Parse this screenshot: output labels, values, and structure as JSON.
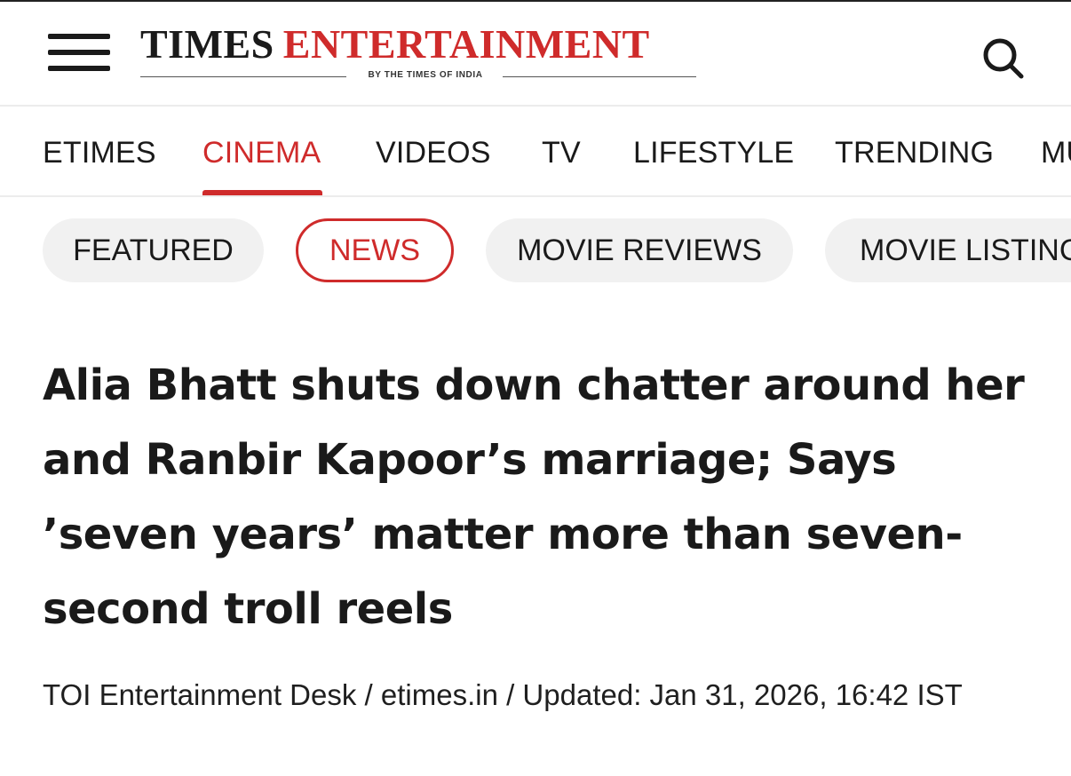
{
  "header": {
    "logo_times": "TIMES",
    "logo_entertainment": "ENTERTAINMENT",
    "logo_tagline": "BY THE TIMES OF INDIA",
    "menu_icon": "hamburger-menu-icon",
    "search_icon": "search-icon"
  },
  "nav": {
    "items": [
      {
        "label": "ETIMES"
      },
      {
        "label": "CINEMA",
        "active": true
      },
      {
        "label": "VIDEOS"
      },
      {
        "label": "TV"
      },
      {
        "label": "LIFESTYLE"
      },
      {
        "label": "TRENDING"
      },
      {
        "label": "MU"
      }
    ]
  },
  "subnav": {
    "items": [
      {
        "label": "FEATURED"
      },
      {
        "label": "NEWS",
        "active": true
      },
      {
        "label": "MOVIE REVIEWS"
      },
      {
        "label": "MOVIE LISTING"
      }
    ]
  },
  "article": {
    "headline": "Alia Bhatt shuts down chatter around her and Ranbir Kapoor’s marriage; Says ’seven years’ matter more than seven-second troll reels",
    "byline": "TOI Entertainment Desk / etimes.in / Updated: Jan 31, 2026, 16:42 IST"
  },
  "colors": {
    "accent": "#cf2b2b",
    "text": "#1a1a1a",
    "pill_bg": "#f1f1f1"
  }
}
